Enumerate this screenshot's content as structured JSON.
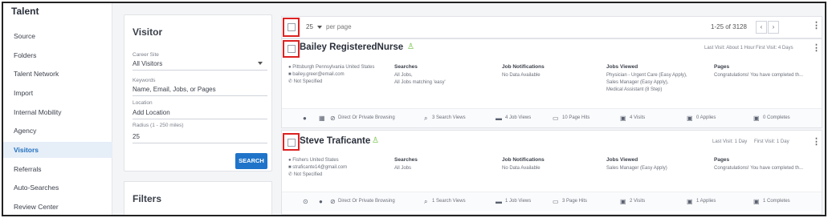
{
  "sidebar": {
    "title": "Talent",
    "items": [
      {
        "label": "Source"
      },
      {
        "label": "Folders"
      },
      {
        "label": "Talent Network"
      },
      {
        "label": "Import"
      },
      {
        "label": "Internal Mobility"
      },
      {
        "label": "Agency"
      },
      {
        "label": "Visitors"
      },
      {
        "label": "Referrals"
      },
      {
        "label": "Auto-Searches"
      },
      {
        "label": "Review Center"
      }
    ],
    "active": "Visitors"
  },
  "visitor_panel": {
    "title": "Visitor",
    "career_site_label": "Career Site",
    "career_site_value": "All Visitors",
    "keywords_label": "Keywords",
    "keywords_placeholder": "Name, Email, Jobs, or Pages",
    "location_label": "Location",
    "location_placeholder": "Add Location",
    "radius_label": "Radius (1 - 250 miles)",
    "radius_value": "25",
    "search_label": "SEARCH"
  },
  "filters_panel": {
    "title": "Filters"
  },
  "toolbar": {
    "per_page_value": "25",
    "per_page_label": "per page",
    "range": "1-25 of 3128",
    "prev": "‹",
    "next": "›"
  },
  "cards": [
    {
      "name": "Bailey RegisteredNurse",
      "last_visit": "Last Visit: About 1 Hour",
      "first_visit": "First Visit: 4 Days",
      "location": "Pittsburgh Pennsylvania United States",
      "email": "bailey.greer@email.com",
      "phone": "Not Specified",
      "searches_label": "Searches",
      "searches": [
        "All Jobs,",
        "All Jobs matching 'easy'"
      ],
      "job_notifications_label": "Job Notifications",
      "job_notifications": "No Data Available",
      "jobs_viewed_label": "Jobs Viewed",
      "jobs_viewed": [
        "Physician - Urgent Care (Easy Apply),",
        "Sales Manager (Easy Apply),",
        "Medical Assistant (8 Step)"
      ],
      "pages_label": "Pages",
      "pages": "Congratulations! You have completed th...",
      "stats": {
        "browsing": "Direct Or Private Browsing",
        "search_views": "3 Search Views",
        "job_views": "4 Job Views",
        "page_hits": "10 Page Hits",
        "visits": "4 Visits",
        "applies": "0 Applies",
        "completes": "0 Completes"
      }
    },
    {
      "name": "Steve Traficante",
      "last_visit": "Last Visit: 1 Day",
      "first_visit": "First Visit: 1 Day",
      "location": "Fishers United States",
      "email": "straficante14@gmail.com",
      "phone": "Not Specified",
      "searches_label": "Searches",
      "searches": [
        "All Jobs"
      ],
      "job_notifications_label": "Job Notifications",
      "job_notifications": "No Data Available",
      "jobs_viewed_label": "Jobs Viewed",
      "jobs_viewed": [
        "Sales Manager (Easy Apply)"
      ],
      "pages_label": "Pages",
      "pages": "Congratulations! You have completed th...",
      "stats": {
        "browsing": "Direct Or Private Browsing",
        "search_views": "1 Search Views",
        "job_views": "1 Job Views",
        "page_hits": "3 Page Hits",
        "visits": "2 Visits",
        "applies": "1 Applies",
        "completes": "1 Completes"
      }
    }
  ],
  "icons": {
    "location": "map-pin-icon",
    "email": "envelope-icon",
    "phone": "phone-icon",
    "person": "person-icon",
    "kebab": "more-vertical-icon"
  },
  "colors": {
    "accent": "#1f74c9",
    "active_nav_bg": "#e6eef8",
    "highlight": "#dd2222",
    "person_icon": "#6bbf3a"
  }
}
